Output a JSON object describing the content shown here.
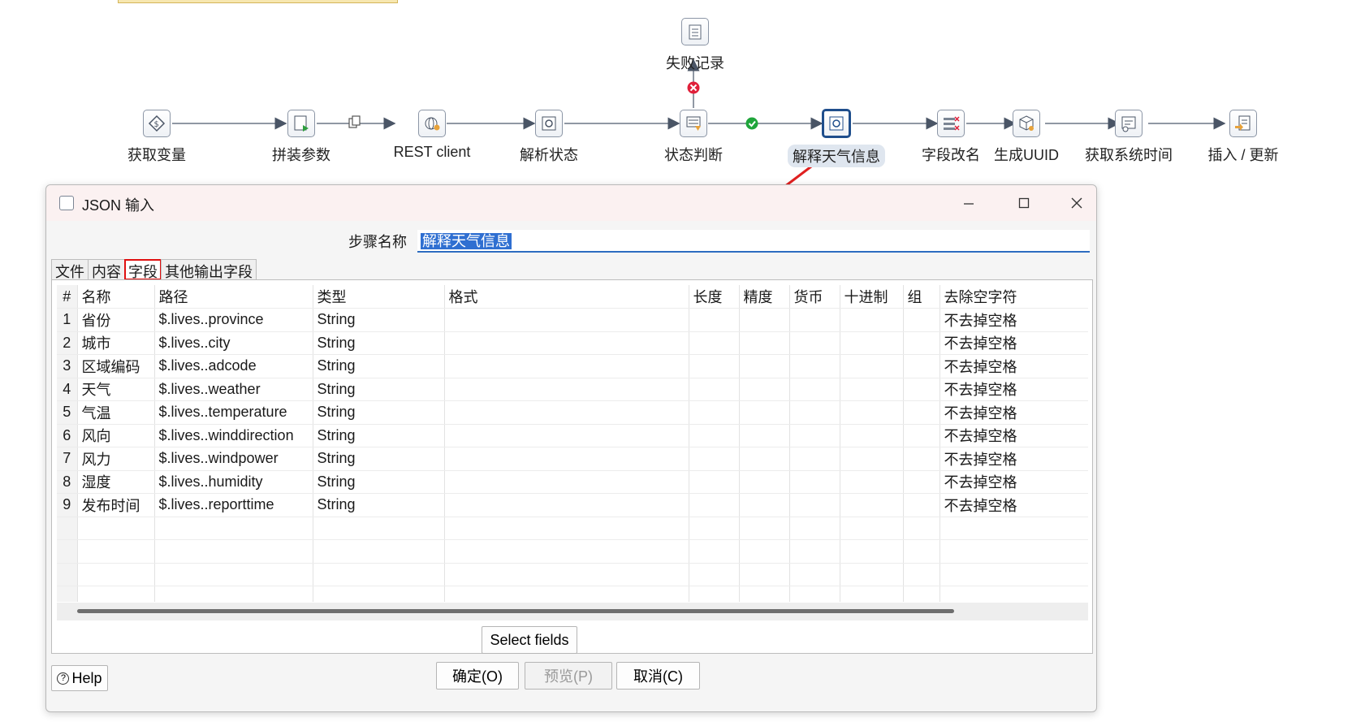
{
  "flow": {
    "failure_node": "失败记录",
    "nodes": [
      {
        "label": "获取变量",
        "icon": "variable-icon"
      },
      {
        "label": "拼装参数",
        "icon": "script-icon"
      },
      {
        "label": "REST client",
        "icon": "rest-globe-icon"
      },
      {
        "label": "解析状态",
        "icon": "json-input-icon"
      },
      {
        "label": "状态判断",
        "icon": "filter-icon"
      },
      {
        "label": "解释天气信息",
        "icon": "json-input-icon"
      },
      {
        "label": "字段改名",
        "icon": "select-values-icon"
      },
      {
        "label": "生成UUID",
        "icon": "uuid-cube-icon"
      },
      {
        "label": "获取系统时间",
        "icon": "system-info-icon"
      },
      {
        "label": "插入 / 更新",
        "icon": "insert-update-icon"
      }
    ]
  },
  "dialog": {
    "title": "JSON 输入",
    "step_name_label": "步骤名称",
    "step_name_value": "解释天气信息",
    "tabs": [
      "文件",
      "内容",
      "字段",
      "其他输出字段"
    ],
    "active_tab": "字段",
    "columns": [
      "#",
      "名称",
      "路径",
      "类型",
      "格式",
      "长度",
      "精度",
      "货币",
      "十进制",
      "组",
      "去除空字符"
    ],
    "rows": [
      {
        "num": "1",
        "name": "省份",
        "path": "$.lives..province",
        "type": "String",
        "trim": "不去掉空格"
      },
      {
        "num": "2",
        "name": "城市",
        "path": "$.lives..city",
        "type": "String",
        "trim": "不去掉空格"
      },
      {
        "num": "3",
        "name": "区域编码",
        "path": "$.lives..adcode",
        "type": "String",
        "trim": "不去掉空格"
      },
      {
        "num": "4",
        "name": "天气",
        "path": "$.lives..weather",
        "type": "String",
        "trim": "不去掉空格"
      },
      {
        "num": "5",
        "name": "气温",
        "path": "$.lives..temperature",
        "type": "String",
        "trim": "不去掉空格"
      },
      {
        "num": "6",
        "name": "风向",
        "path": "$.lives..winddirection",
        "type": "String",
        "trim": "不去掉空格"
      },
      {
        "num": "7",
        "name": "风力",
        "path": "$.lives..windpower",
        "type": "String",
        "trim": "不去掉空格"
      },
      {
        "num": "8",
        "name": "湿度",
        "path": "$.lives..humidity",
        "type": "String",
        "trim": "不去掉空格"
      },
      {
        "num": "9",
        "name": "发布时间",
        "path": "$.lives..reporttime",
        "type": "String",
        "trim": "不去掉空格"
      }
    ],
    "select_fields_label": "Select fields",
    "help_label": "Help",
    "ok_label": "确定(O)",
    "preview_label": "预览(P)",
    "cancel_label": "取消(C)",
    "highlight_color": "#e01010",
    "accent_color": "#2f6fd1"
  }
}
